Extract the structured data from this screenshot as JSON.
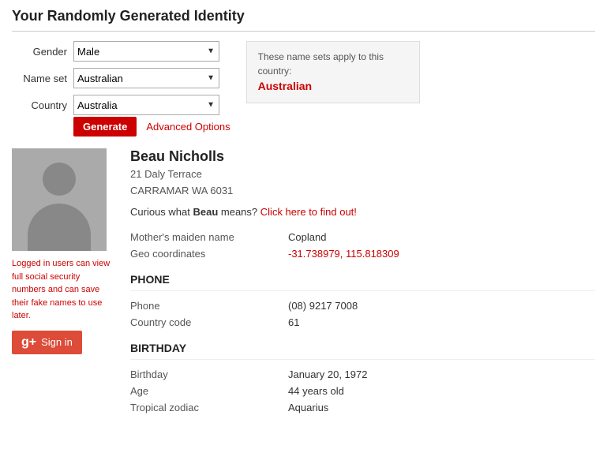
{
  "page": {
    "title": "Your Randomly Generated Identity"
  },
  "form": {
    "gender_label": "Gender",
    "nameset_label": "Name set",
    "country_label": "Country",
    "gender_value": "Male",
    "nameset_value": "Australian",
    "country_value": "Australia",
    "generate_label": "Generate",
    "advanced_label": "Advanced Options"
  },
  "nameset_info": {
    "text": "These name sets apply to this country:",
    "value": "Australian"
  },
  "avatar": {
    "info_text": "Logged in users can view full social security numbers and can save their fake names to use later.",
    "signin_label": "Sign in"
  },
  "profile": {
    "name": "Beau Nicholls",
    "address_line1": "21 Daly Terrace",
    "address_line2": "CARRAMAR WA 6031",
    "curious_text": "Curious what ",
    "curious_name": "Beau",
    "curious_suffix": " means?",
    "curious_link": "Click here to find out!",
    "mothers_maiden_label": "Mother's maiden name",
    "mothers_maiden_value": "Copland",
    "geo_label": "Geo coordinates",
    "geo_value": "-31.738979, 115.818309"
  },
  "phone_section": {
    "title": "PHONE",
    "phone_label": "Phone",
    "phone_value": "(08) 9217 7008",
    "country_code_label": "Country code",
    "country_code_value": "61"
  },
  "birthday_section": {
    "title": "BIRTHDAY",
    "birthday_label": "Birthday",
    "birthday_value": "January 20, 1972",
    "age_label": "Age",
    "age_value": "44 years old",
    "zodiac_label": "Tropical zodiac",
    "zodiac_value": "Aquarius"
  }
}
